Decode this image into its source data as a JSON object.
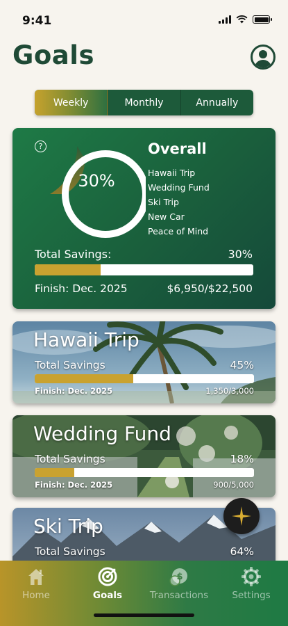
{
  "status_bar": {
    "time": "9:41"
  },
  "header": {
    "title": "Goals"
  },
  "period_tabs": [
    {
      "label": "Weekly",
      "active": true
    },
    {
      "label": "Monthly",
      "active": false
    },
    {
      "label": "Annually",
      "active": false
    }
  ],
  "overall": {
    "title": "Overall",
    "percent_label": "30%",
    "percent": 30,
    "goals": [
      "Hawaii Trip",
      "Wedding Fund",
      "Ski Trip",
      "New Car",
      "Peace of Mind"
    ],
    "total_label": "Total Savings:",
    "total_percent": "30%",
    "progress": 0.3,
    "finish": "Finish: Dec. 2025",
    "amount": "$6,950/$22,500"
  },
  "goal_cards": [
    {
      "title": "Hawaii Trip",
      "label": "Total Savings",
      "percent": "45%",
      "progress": 0.45,
      "finish": "Finish: Dec. 2025",
      "amount": "1,350/3,000"
    },
    {
      "title": "Wedding Fund",
      "label": "Total Savings",
      "percent": "18%",
      "progress": 0.18,
      "finish": "Finish: Dec. 2025",
      "amount": "900/5,000"
    },
    {
      "title": "Ski Trip",
      "label": "Total Savings",
      "percent": "64%",
      "progress": 0.64
    }
  ],
  "tab_bar": [
    {
      "label": "Home",
      "icon": "home-icon",
      "active": false
    },
    {
      "label": "Goals",
      "icon": "target-icon",
      "active": true
    },
    {
      "label": "Transactions",
      "icon": "money-icon",
      "active": false
    },
    {
      "label": "Settings",
      "icon": "gear-icon",
      "active": false
    }
  ],
  "colors": {
    "primary_green": "#1e7a46",
    "gold": "#c9a230",
    "title_green": "#1f4a36"
  }
}
